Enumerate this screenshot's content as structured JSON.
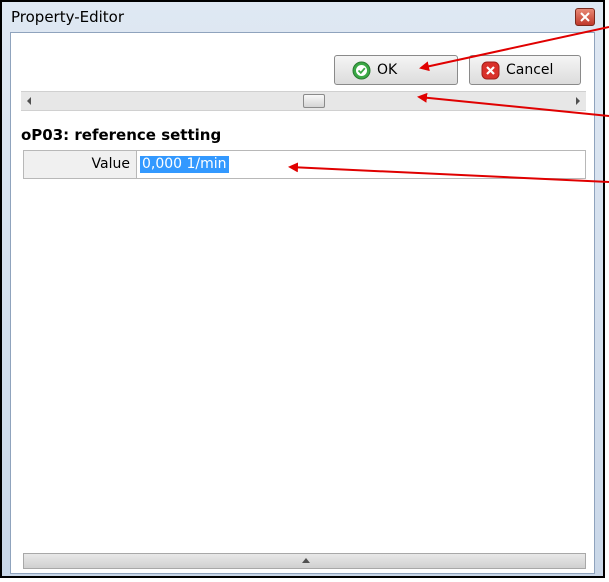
{
  "window": {
    "title": "Property-Editor"
  },
  "toolbar": {
    "ok_label": "OK",
    "cancel_label": "Cancel"
  },
  "icons": {
    "close": "close-icon",
    "ok": "checkmark-icon",
    "cancel": "cancel-x-icon",
    "scroll_left": "arrow-left-icon",
    "scroll_right": "arrow-right-icon",
    "expand": "arrow-up-icon"
  },
  "property": {
    "section_title": "oP03: reference setting",
    "label": "Value",
    "value": "0,000 1/min"
  },
  "colors": {
    "selection": "#3399ff",
    "annotation_arrow": "#e00000",
    "close_button": "#c0392b",
    "ok_icon": "#3aa845",
    "cancel_icon": "#d9312b"
  }
}
